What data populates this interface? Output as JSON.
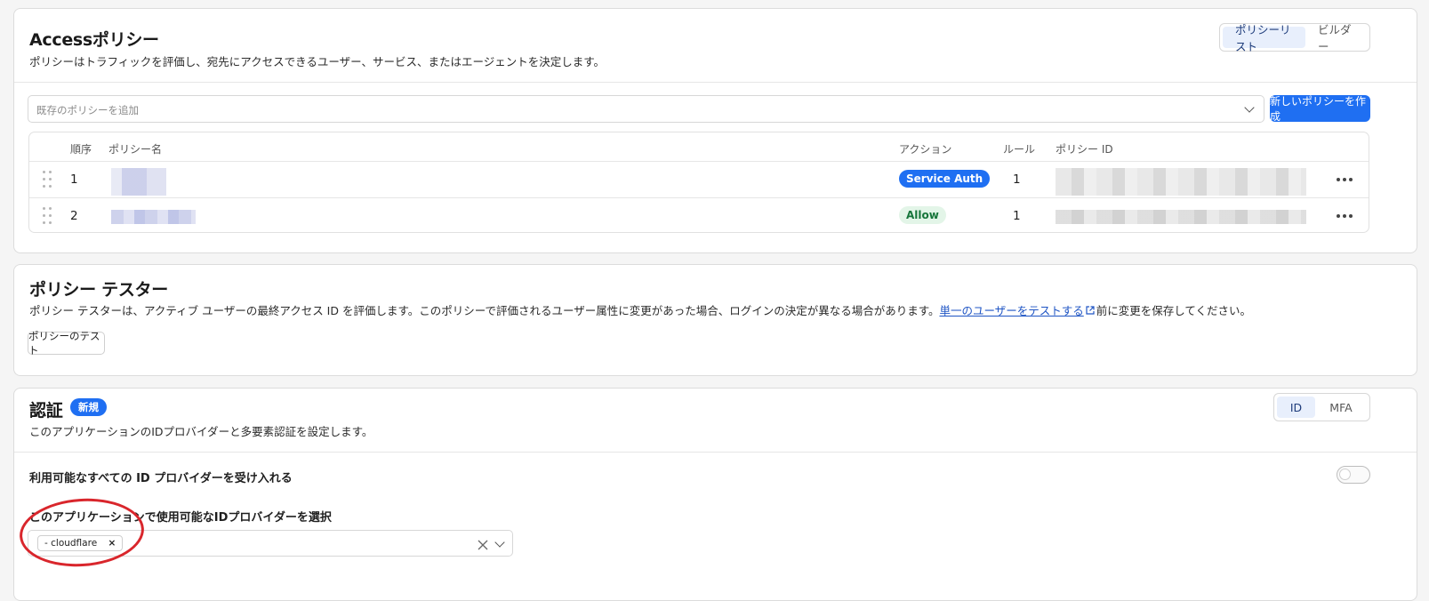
{
  "access": {
    "title": "Accessポリシー",
    "description": "ポリシーはトラフィックを評価し、宛先にアクセスできるユーザー、サービス、またはエージェントを決定します。",
    "view_tabs": [
      "ポリシーリスト",
      "ビルダー"
    ],
    "active_tab": "ポリシーリスト",
    "add_placeholder": "既存のポリシーを追加",
    "create_button": "新しいポリシーを作成",
    "columns": {
      "order": "順序",
      "name": "ポリシー名",
      "action": "アクション",
      "rules": "ルール",
      "policy_id": "ポリシー ID"
    },
    "rows": [
      {
        "order": "1",
        "action": "Service Auth",
        "rules": "1"
      },
      {
        "order": "2",
        "action": "Allow",
        "rules": "1"
      }
    ]
  },
  "tester": {
    "title": "ポリシー テスター",
    "description_before": "ポリシー テスターは、アクティブ ユーザーの最終アクセス ID を評価します。このポリシーで評価されるユーザー属性に変更があった場合、ログインの決定が異なる場合があります。",
    "link_text": "単一のユーザーをテストする",
    "description_after": "前に変更を保存してください。",
    "test_button": "ポリシーのテスト"
  },
  "auth": {
    "title": "認証",
    "new_badge": "新規",
    "description": "このアプリケーションのIDプロバイダーと多要素認証を設定します。",
    "tabs": [
      "ID",
      "MFA"
    ],
    "active_tab": "ID",
    "accept_all_label": "利用可能なすべての ID プロバイダーを受け入れる",
    "accept_all_enabled": false,
    "select_label": "このアプリケーションで使用可能なIDプロバイダーを選択",
    "selected_chip": "- cloudflare",
    "chip_remove": "×"
  },
  "colors": {
    "accent": "#1f6ff2",
    "highlight_circle": "#d9262c"
  }
}
